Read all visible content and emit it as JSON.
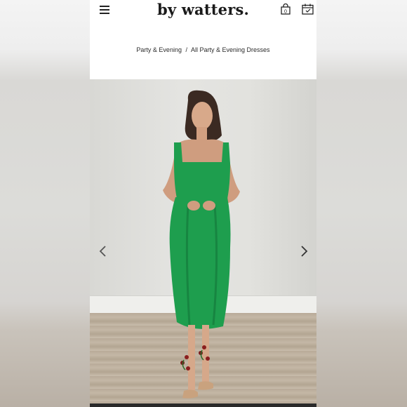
{
  "header": {
    "logo_text": "by watters.",
    "menu_icon": "hamburger-menu-icon",
    "cart_icon": "shopping-bag-icon",
    "cart_count": "0",
    "appointment_icon": "calendar-check-icon"
  },
  "breadcrumb": {
    "items": [
      {
        "label": "Party & Evening"
      },
      {
        "label": "All Party & Evening Dresses"
      }
    ],
    "separator": "/"
  },
  "gallery": {
    "prev_icon": "chevron-left-icon",
    "next_icon": "chevron-right-icon"
  },
  "colors": {
    "dress": "#1e9e4e",
    "text": "#1a1a1a",
    "background": "#ffffff"
  }
}
